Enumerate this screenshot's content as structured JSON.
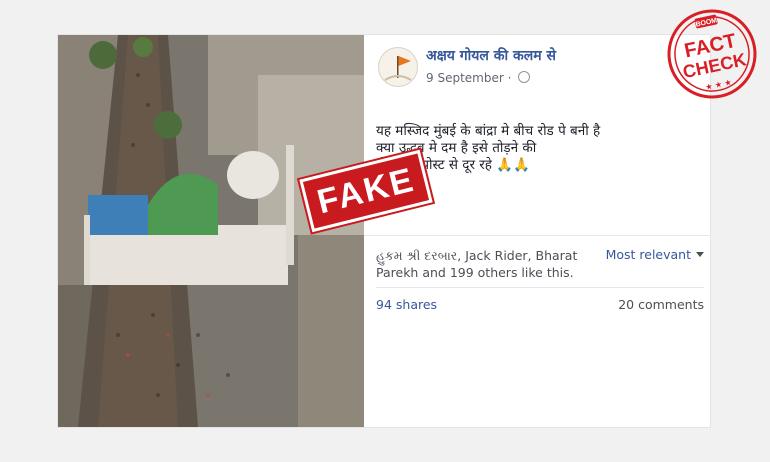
{
  "post": {
    "page_name": "अक्षय गोयल की कलम से",
    "date": "9 September",
    "date_separator": "·",
    "text_lines": [
      "यह मस्जिद मुंबई के बांद्रा मे बीच रोड पे बनी है",
      "क्या उद्धव मे दम है इसे तोड़ने की",
      "हीरो मेरी पोस्ट से दूर रहे 🙏🙏"
    ],
    "likes_text": "હુકમ શ્રી દરબાર, Jack Rider, Bharat Parekh and 199 others like this.",
    "sort_label": "Most relevant",
    "shares": "94 shares",
    "comments": "20 comments"
  },
  "overlays": {
    "fake_stamp": "FAKE",
    "badge_top": "BOOM",
    "badge_line1": "FACT",
    "badge_line2": "CHECK",
    "badge_color": "#d81f26"
  },
  "icons": {
    "avatar": "flag-avatar-icon",
    "audience": "globe-icon",
    "sort_caret": "caret-down-icon"
  }
}
